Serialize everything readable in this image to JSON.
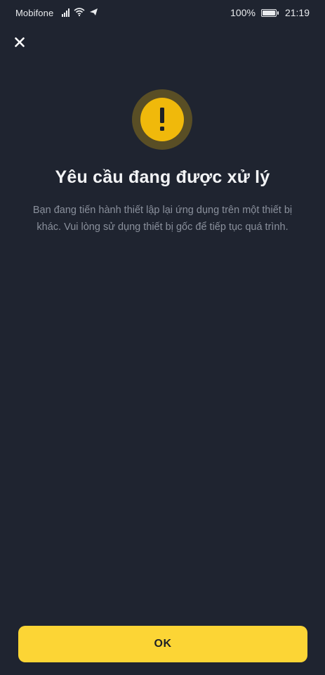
{
  "status_bar": {
    "carrier": "Mobifone",
    "battery": "100%",
    "time": "21:19",
    "icons": [
      "signal-icon",
      "wifi-icon",
      "send-icon",
      "battery-icon"
    ]
  },
  "header": {
    "close_icon": "close-icon"
  },
  "alert": {
    "icon": "warning-icon",
    "icon_glyph": "!",
    "title": "Yêu cầu đang được xử lý",
    "message": "Bạn đang tiến hành thiết lập lại ứng dụng trên một thiết bị khác. Vui lòng sử dụng thiết bị gốc để tiếp tục quá trình."
  },
  "actions": {
    "ok_label": "OK"
  },
  "colors": {
    "background": "#1f2430",
    "accent": "#fcd535",
    "warning": "#f0b90b",
    "text_primary": "#f2f3f5",
    "text_secondary": "#8a909c"
  }
}
